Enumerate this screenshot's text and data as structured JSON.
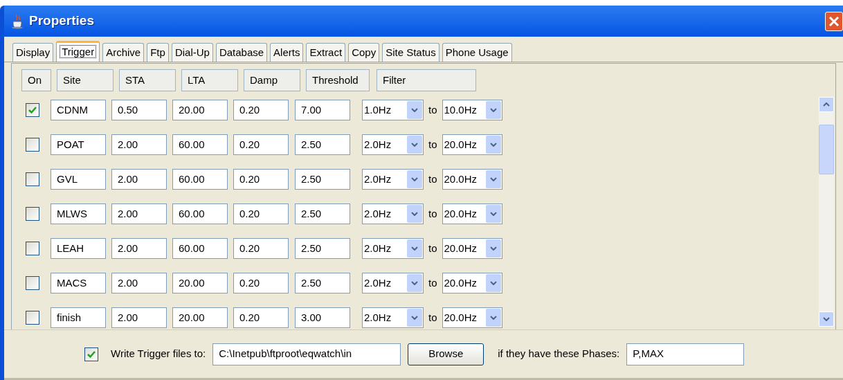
{
  "window": {
    "title": "Properties"
  },
  "tabs": [
    {
      "label": "Display",
      "selected": false
    },
    {
      "label": "Trigger",
      "selected": true
    },
    {
      "label": "Archive",
      "selected": false
    },
    {
      "label": "Ftp",
      "selected": false
    },
    {
      "label": "Dial-Up",
      "selected": false
    },
    {
      "label": "Database",
      "selected": false
    },
    {
      "label": "Alerts",
      "selected": false
    },
    {
      "label": "Extract",
      "selected": false
    },
    {
      "label": "Copy",
      "selected": false
    },
    {
      "label": "Site Status",
      "selected": false
    },
    {
      "label": "Phone Usage",
      "selected": false
    }
  ],
  "columns": [
    "On",
    "Site",
    "STA",
    "LTA",
    "Damp",
    "Threshold",
    "Filter"
  ],
  "rows": [
    {
      "on": true,
      "site": "CDNM",
      "sta": "0.50",
      "lta": "20.00",
      "damp": "0.20",
      "threshold": "7.00",
      "filter_from": "1.0Hz",
      "to": "to",
      "filter_to": "10.0Hz"
    },
    {
      "on": false,
      "site": "POAT",
      "sta": "2.00",
      "lta": "60.00",
      "damp": "0.20",
      "threshold": "2.50",
      "filter_from": "2.0Hz",
      "to": "to",
      "filter_to": "20.0Hz"
    },
    {
      "on": false,
      "site": "GVL",
      "sta": "2.00",
      "lta": "60.00",
      "damp": "0.20",
      "threshold": "2.50",
      "filter_from": "2.0Hz",
      "to": "to",
      "filter_to": "20.0Hz"
    },
    {
      "on": false,
      "site": "MLWS",
      "sta": "2.00",
      "lta": "60.00",
      "damp": "0.20",
      "threshold": "2.50",
      "filter_from": "2.0Hz",
      "to": "to",
      "filter_to": "20.0Hz"
    },
    {
      "on": false,
      "site": "LEAH",
      "sta": "2.00",
      "lta": "60.00",
      "damp": "0.20",
      "threshold": "2.50",
      "filter_from": "2.0Hz",
      "to": "to",
      "filter_to": "20.0Hz"
    },
    {
      "on": false,
      "site": "MACS",
      "sta": "2.00",
      "lta": "20.00",
      "damp": "0.20",
      "threshold": "2.50",
      "filter_from": "2.0Hz",
      "to": "to",
      "filter_to": "20.0Hz"
    },
    {
      "on": false,
      "site": "finish",
      "sta": "2.00",
      "lta": "20.00",
      "damp": "0.20",
      "threshold": "3.00",
      "filter_from": "2.0Hz",
      "to": "to",
      "filter_to": "20.0Hz"
    }
  ],
  "footer": {
    "write_checked": true,
    "write_label": "Write Trigger files to:",
    "path": "C:\\Inetpub\\ftproot\\eqwatch\\in",
    "browse": "Browse",
    "phases_label": "if they have these Phases:",
    "phases": "P,MAX"
  }
}
